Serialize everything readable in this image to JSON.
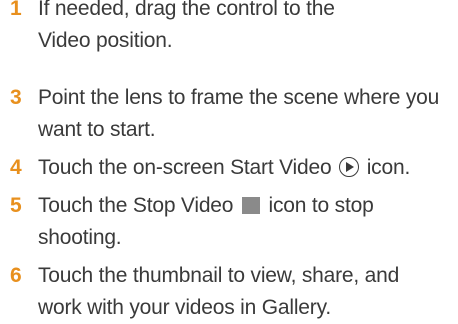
{
  "steps": [
    {
      "number": "1",
      "lines": [
        "If needed, drag the control to the",
        "Video position."
      ]
    },
    {
      "number": "3",
      "lines": [
        "Point the lens to frame the scene where you",
        "want to start."
      ]
    },
    {
      "number": "4",
      "before": "Touch the on-screen Start Video",
      "after": "icon.",
      "icon": "play-circle-icon"
    },
    {
      "number": "5",
      "before": "Touch the Stop Video",
      "after": "icon to stop",
      "line2": "shooting.",
      "icon": "stop-square-icon"
    },
    {
      "number": "6",
      "lines": [
        "Touch the thumbnail to view, share, and",
        "work with your videos in Gallery."
      ]
    }
  ],
  "colors": {
    "number": "#e8901e",
    "text": "#3a3a3a",
    "stop_icon": "#8a8a8a"
  }
}
